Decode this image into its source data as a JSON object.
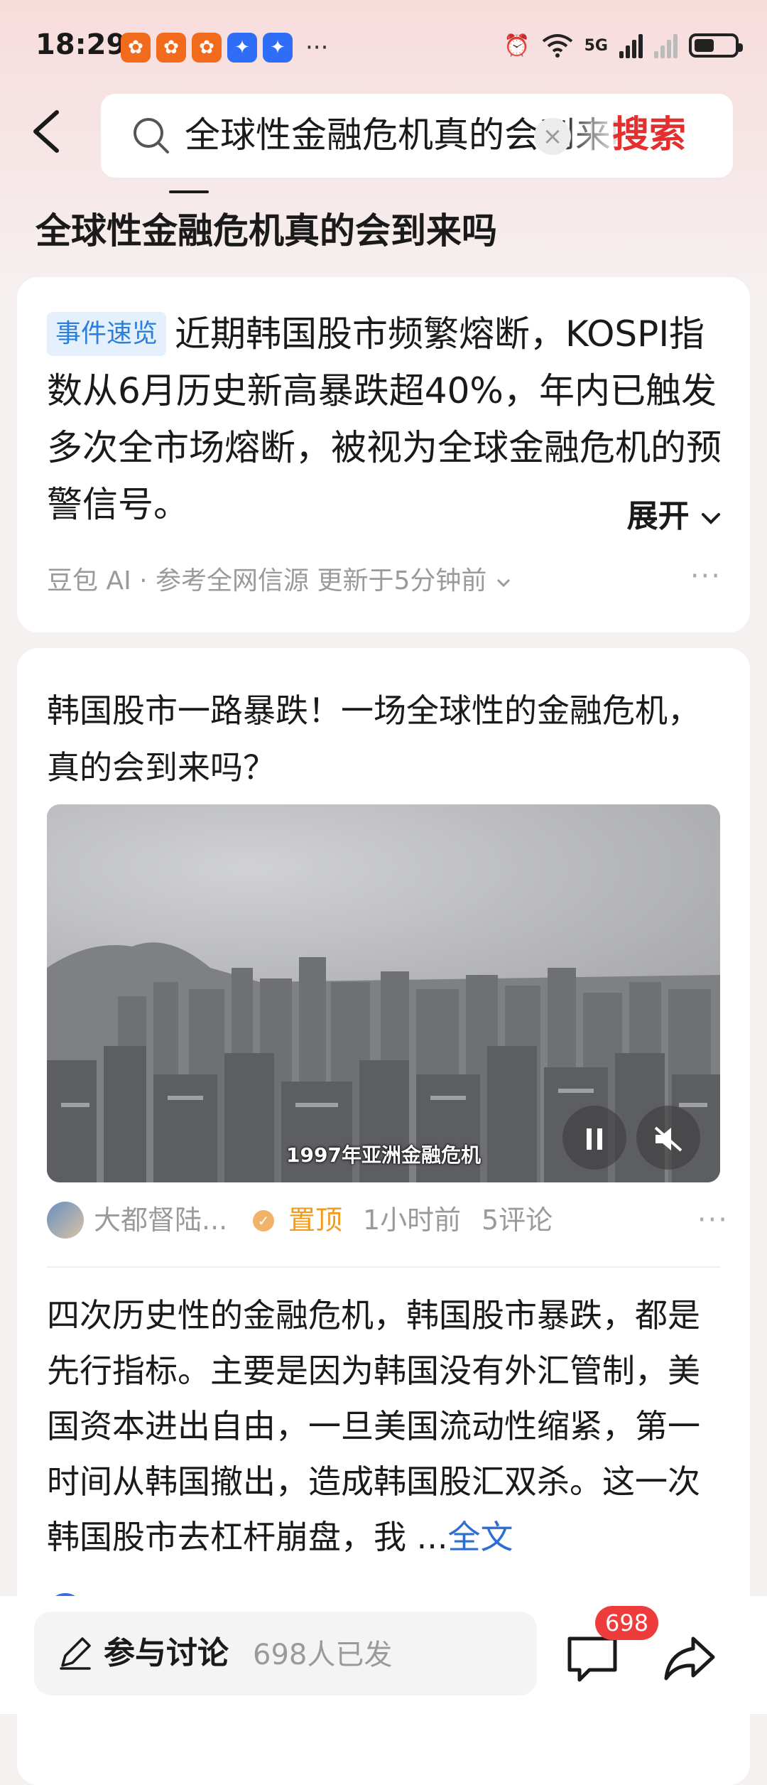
{
  "status_bar": {
    "time": "18:29",
    "network": "5G",
    "more": "···"
  },
  "search": {
    "query": "全球性金融危机真的会到来吗",
    "button_label": "搜索",
    "clear_symbol": "×"
  },
  "page_title": "全球性金融危机真的会到来吗",
  "ai_summary": {
    "tag": "事件速览",
    "text": "近期韩国股市频繁熔断，KOSPI指数从6月历史新高暴跌超40%，年内已触发多次全市场熔断，被视为全球金融危机的预警信号。",
    "expand_label": "展开",
    "meta": "豆包 AI · 参考全网信源 更新于5分钟前",
    "more": "···"
  },
  "article": {
    "title": "韩国股市一路暴跌！一场全球性的金融危机，真的会到来吗？",
    "video_caption": "1997年亚洲金融危机",
    "author": "大都督陆...",
    "pin_label": "置顶",
    "time_ago": "1小时前",
    "comments": "5评论",
    "more": "···"
  },
  "post": {
    "text": "四次历史性的金融危机，韩国股市暴跌，都是先行指标。主要是因为韩国没有外汇管制，美国资本进出自由，一旦美国流动性缩紧，第一时间从韩国撤出，造成韩国股汇双杀。这一次韩国股市去杠杆崩盘，我",
    "ellipsis": "...",
    "full_text_label": "全文"
  },
  "bottom_bar": {
    "discuss_label": "参与讨论",
    "discuss_count": "698人已发",
    "comment_badge": "698"
  },
  "colors": {
    "accent_red": "#e52e2e",
    "tag_blue": "#2d7fdc",
    "pin_orange": "#f39a1e",
    "link_blue": "#2d6fd1"
  }
}
